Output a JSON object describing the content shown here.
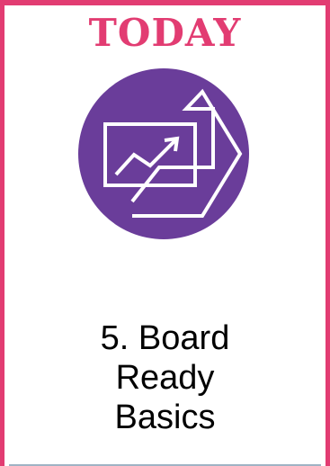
{
  "header": {
    "label": "TODAY"
  },
  "lesson": {
    "title_lines": [
      "5. Board",
      "Ready",
      "Basics"
    ]
  },
  "icon": {
    "name": "presentation-chart-arrow-icon"
  },
  "colors": {
    "frame": "#e23c72",
    "headline": "#e23c72",
    "icon_circle": "#6a3d9a",
    "icon_stroke": "#ffffff"
  }
}
